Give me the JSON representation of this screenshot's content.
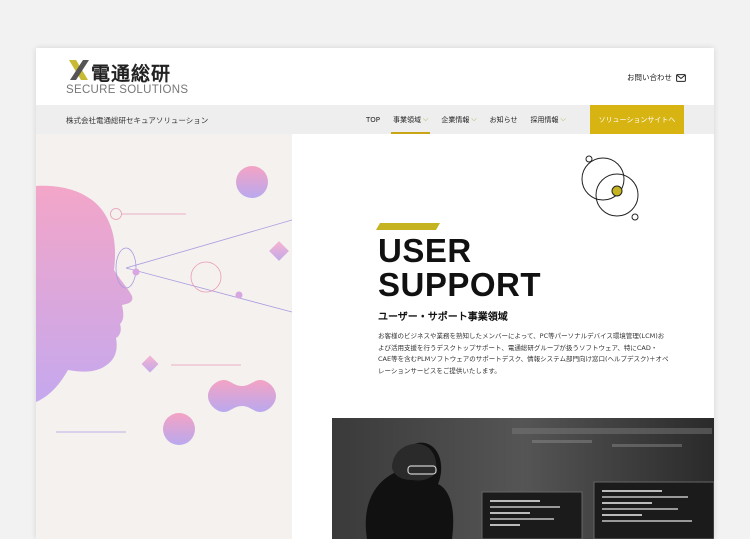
{
  "header": {
    "logo_ja": "電通総研",
    "logo_en": "SECURE SOLUTIONS",
    "contact_label": "お問い合わせ"
  },
  "navbar": {
    "company_name": "株式会社電通総研セキュアソリューション",
    "items": [
      {
        "label": "TOP",
        "dropdown": false
      },
      {
        "label": "事業領域",
        "dropdown": true,
        "active": true
      },
      {
        "label": "企業情報",
        "dropdown": true
      },
      {
        "label": "お知らせ",
        "dropdown": false
      },
      {
        "label": "採用情報",
        "dropdown": true
      }
    ],
    "cta_label": "ソリューションサイトへ"
  },
  "hero": {
    "title_line1": "USER",
    "title_line2": "SUPPORT",
    "subtitle": "ユーザー・サポート事業領域",
    "description": "お客様のビジネスや業務を熟知したメンバーによって、PC等パーソナルデバイス環境管理(LCM)および活用支援を行うデスクトップサポート、電通総研グループが扱うソフトウェア、特にCAD・CAE等を含むPLMソフトウェアのサポートデスク、情報システム部門向け窓口(ヘルプデスク)＋オペレーションサービスをご提供いたします。"
  },
  "colors": {
    "accent_yellow": "#d7b412",
    "accent_olive": "#c6b322",
    "nav_bg": "#eeeeee",
    "illustration_bg": "#f4f1ee",
    "gradient_pink": "#f4a3c4",
    "gradient_violet": "#b9a8ee"
  },
  "icons": {
    "contact": "mail-icon",
    "dropdown": "chevron-down-icon",
    "logo": "logo-x-mark"
  }
}
